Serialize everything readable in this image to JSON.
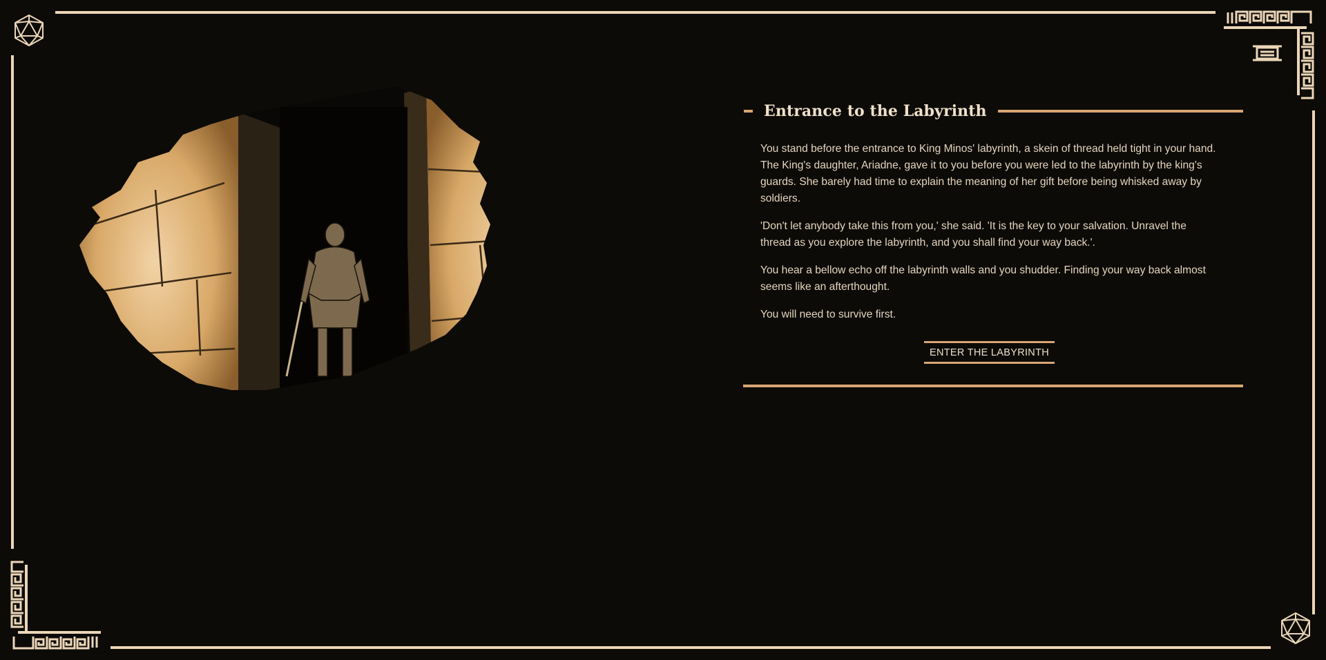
{
  "scene": {
    "image_alt": "Warrior standing at the dark stone entrance of the labyrinth"
  },
  "story": {
    "title": "Entrance to the Labyrinth",
    "paragraphs": [
      "You stand before the entrance to King Minos' labyrinth, a skein of thread held tight in your hand. The King's daughter, Ariadne, gave it to you before you were led to the labyrinth by the king's guards. She barely had time to explain the meaning of her gift before being whisked away by soldiers.",
      "'Don't let anybody take this from you,' she said. 'It is the key to your salvation. Unravel the thread as you explore the labyrinth, and you shall find your way back.'.",
      "You hear a bellow echo off the labyrinth walls and you shudder. Finding your way back almost seems like an afterthought.",
      "You will need to survive first."
    ],
    "enter_button": "ENTER THE LABYRINTH"
  },
  "colors": {
    "background": "#0c0b08",
    "frame": "#ecd6b8",
    "accent": "#d9a573",
    "text": "#e7d6bf"
  },
  "icons": {
    "dice": "d20-icon",
    "menu": "scroll-menu-icon",
    "border": "greek-key-icon"
  }
}
